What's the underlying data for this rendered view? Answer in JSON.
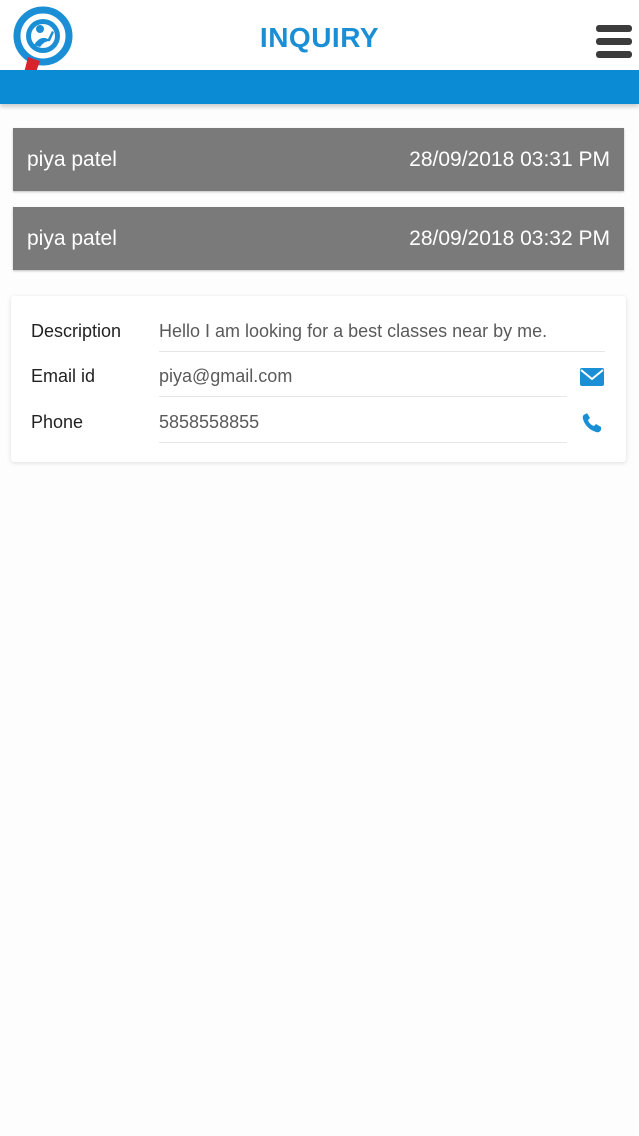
{
  "header": {
    "title": "INQUIRY",
    "logo_icon": "magnifier-logo-icon",
    "menu_icon": "hamburger-menu-icon",
    "accent_color": "#0b8bd3"
  },
  "inquiries": [
    {
      "name": "piya patel",
      "datetime": "28/09/2018 03:31 PM"
    },
    {
      "name": "piya patel",
      "datetime": "28/09/2018 03:32 PM"
    }
  ],
  "detail": {
    "description_label": "Description",
    "description_value": "Hello I am looking for a best classes near by me.",
    "email_label": "Email id",
    "email_value": "piya@gmail.com",
    "email_icon": "envelope-icon",
    "phone_label": "Phone",
    "phone_value": "5858558855",
    "phone_icon": "phone-icon"
  }
}
